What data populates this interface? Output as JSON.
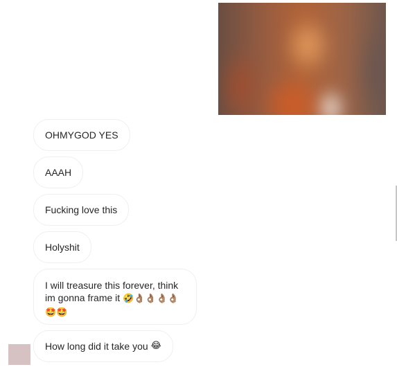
{
  "thread": {
    "outgoing_media": {
      "type": "photo",
      "blurred": true
    },
    "incoming_messages": [
      {
        "text": "OHMYGOD YES",
        "emoji": ""
      },
      {
        "text": "AAAH",
        "emoji": ""
      },
      {
        "text": "Fucking love this",
        "emoji": ""
      },
      {
        "text": "Holyshit",
        "emoji": ""
      },
      {
        "text": "I will treasure this forever, think im gonna frame it",
        "emoji": "🤣👌🏽👌🏽👌🏽👌🏽🤩🤩"
      },
      {
        "text": "How long did it take you",
        "emoji": "😂"
      }
    ],
    "sender": {
      "avatar": "avatar-thumbnail",
      "avatar_color": "#d6c2c3"
    }
  },
  "theme": {
    "bubble_border": "#efefef",
    "text_color": "#262626"
  }
}
